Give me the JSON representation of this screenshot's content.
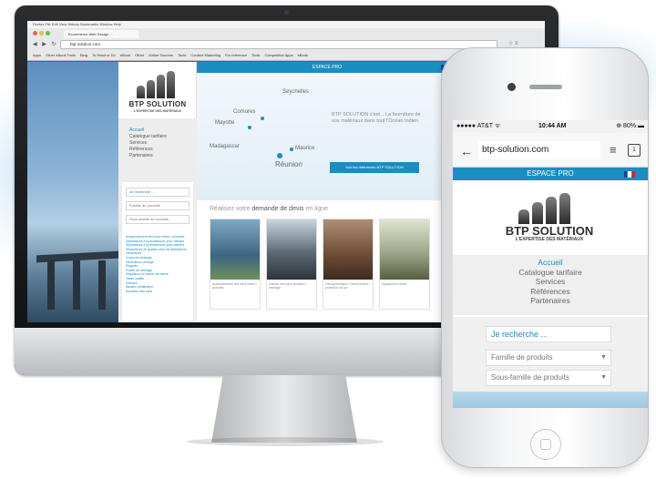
{
  "desktop": {
    "menubar": "Firefox   File   Edit   View   History   Bookmarks   Window   Help",
    "tab_title": "Ecommerce Web Design ...",
    "url": "btp-solution.com",
    "nav_buttons": "◀ ▶ ↻",
    "url_icons": "☆ ≡",
    "bookmarks": [
      "Apps",
      "Other eBook Tools",
      "Blog",
      "To Read or Do",
      "eBook",
      "Other",
      "Airline Sources",
      "Tools",
      "Content Marketing",
      "For reference",
      "Tools",
      "Competitive Apps",
      "eBook"
    ],
    "site": {
      "logo_name": "BTP SOLUTION",
      "logo_tagline": "L'EXPERTISE DES MATÉRIAUX",
      "nav": [
        "Accueil",
        "Catalogue tarifaire",
        "Services",
        "Références",
        "Partenaires"
      ],
      "search_placeholder": "Je recherche ...",
      "family_select": "Famille de produits",
      "subfamily_select": "Sous-famille de produits",
      "category_list": [
        "Assainissement des eaux usées / pluviales",
        "Séparateurs à hydrocarbures pour bassins",
        "Séparateurs à hydrocarbures pour bassins",
        "Séparateurs de graisse et/ou de déshuileurs",
        "Décanteurs",
        "Cuves de stockage",
        "Déshuileurs d'usage",
        "Regards",
        "Postes de relevage",
        "Dégrilleurs et bâches de relève",
        "Tamis rotatifs",
        "Clôtures",
        "Bassins d'infiltration",
        "Epuration des eaux"
      ],
      "espace_pro": "ESPACE PRO",
      "map_labels": {
        "seychelles": "Seychelles",
        "comores": "Comores",
        "mayotte": "Mayotte",
        "madagascar": "Madagascar",
        "maurice": "Maurice",
        "reunion": "Réunion"
      },
      "hero_text": "BTP SOLUTION c'est... La fourniture de vos matériaux dans tout l'Océan Indien",
      "hero_arrow": "›",
      "hero_button": "Voir les références BTP SOLUTION",
      "devis_prefix": "Réalisez votre",
      "devis_highlight": "demande de devis",
      "devis_suffix": "en ligne",
      "thumbs": [
        "Assainissement des eaux usées / pluviales",
        "Gestion des eaux pluviales / drainage",
        "Géosynthétiques / renforcement / protection du sol",
        "Equipement urbain"
      ]
    }
  },
  "mobile": {
    "carrier": "●●●●● AT&T ᯤ",
    "time": "10:44 AM",
    "battery": "⊕ 80% ▬",
    "back": "←",
    "url": "btp-solution.com",
    "menu_icon": "≡",
    "tabs_count": "1",
    "espace_pro": "ESPACE PRO",
    "logo_name": "BTP SOLUTION",
    "logo_tagline": "L'EXPERTISE DES MATÉRIAUX",
    "nav": [
      "Accueil",
      "Catalogue tarifaire",
      "Services",
      "Références",
      "Partenaires"
    ],
    "search_placeholder": "Je recherche ...",
    "family_select": "Famille de produits",
    "subfamily_select": "Sous-famille de produits",
    "caret": "▼"
  },
  "colors": {
    "accent": "#1b8dc0",
    "flag_blue": "#1f3f9a",
    "flag_white": "#ffffff",
    "flag_red": "#d9241f"
  }
}
